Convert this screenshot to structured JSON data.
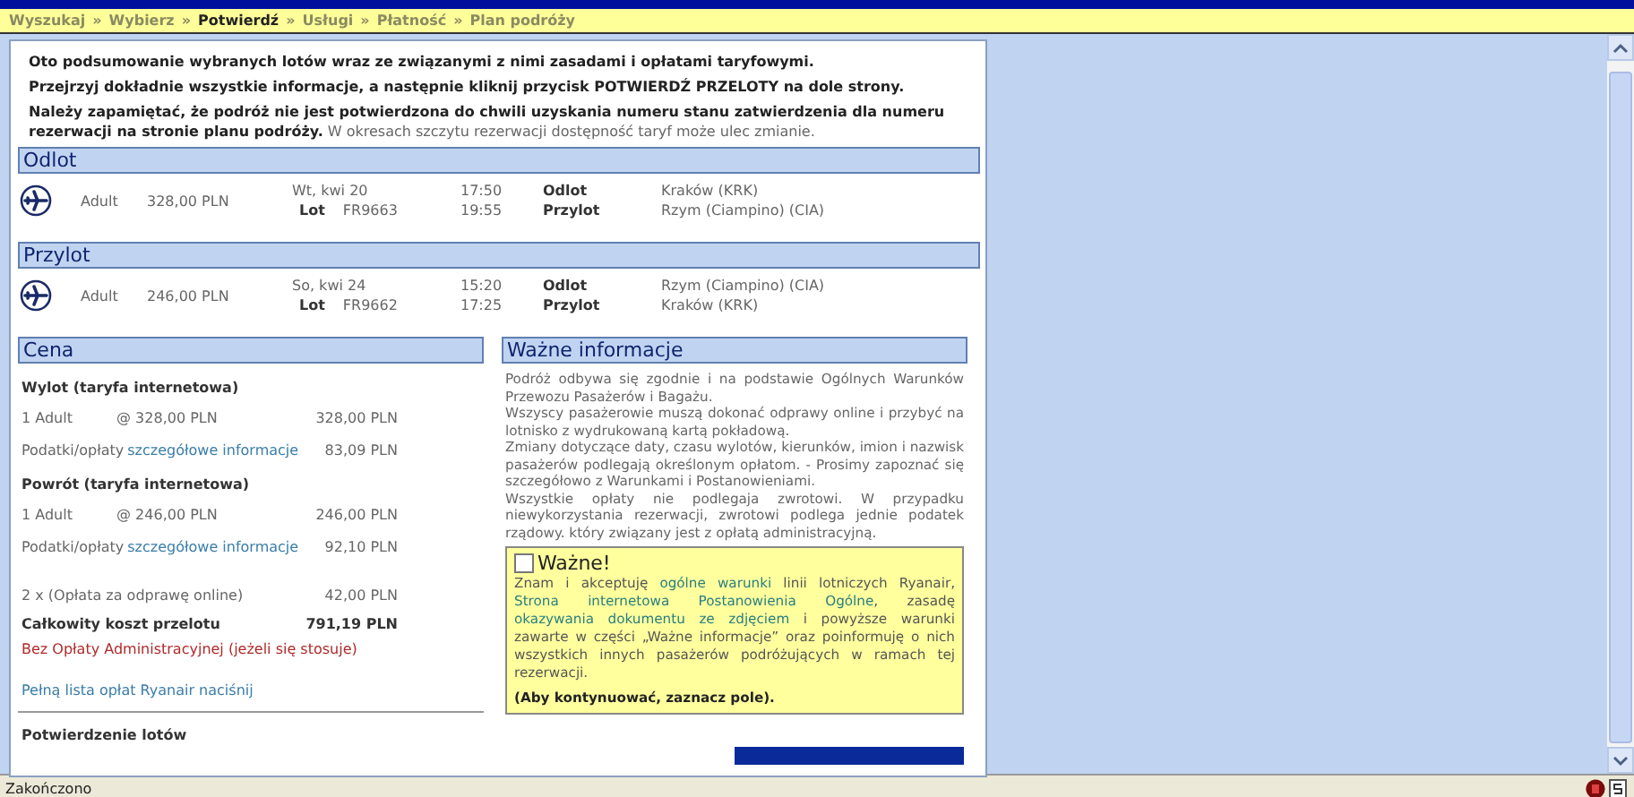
{
  "breadcrumb": [
    {
      "label": "Wyszukaj",
      "selected": false
    },
    {
      "label": "Wybierz",
      "selected": false
    },
    {
      "label": "Potwierdź",
      "selected": true
    },
    {
      "label": "Usługi",
      "selected": false
    },
    {
      "label": "Płatność",
      "selected": false
    },
    {
      "label": "Plan podróży",
      "selected": false
    }
  ],
  "breadcrumb_separator": "»",
  "intro": [
    {
      "text": "Oto podsumowanie wybranych lotów wraz ze związanymi z nimi zasadami i opłatami taryfowymi.",
      "strong": true
    },
    {
      "text": "Przejrzyj dokładnie wszystkie informacje, a następnie kliknij przycisk POTWIERDŹ PRZELOTY na dole strony.",
      "strong": true
    },
    {
      "text": "**Należy zapamiętać, że podróż nie jest potwierdzona do chwili uzyskania numeru stanu zatwierdzenia dla numeru rezerwacji na stronie planu podróży.** W okresach szczytu rezerwacji dostępność taryf może ulec zmianie.",
      "strong": false
    }
  ],
  "flights": [
    {
      "title": "Odlot",
      "rows": [
        {
          "passenger": "Adult",
          "price": "328,00 PLN",
          "date": "Wt, kwi 20",
          "flight_label": "Lot",
          "flight_number": "FR9663",
          "departure_time": "17:50",
          "arrival_time": "19:55",
          "departure_label": "Odlot",
          "arrival_label": "Przylot",
          "departure_airport": "Kraków (KRK)",
          "arrival_airport": "Rzym (Ciampino) (CIA)"
        }
      ]
    },
    {
      "title": "Przylot",
      "rows": [
        {
          "passenger": "Adult",
          "price": "246,00 PLN",
          "date": "So, kwi 24",
          "flight_label": "Lot",
          "flight_number": "FR9662",
          "departure_time": "15:20",
          "arrival_time": "17:25",
          "departure_label": "Odlot",
          "arrival_label": "Przylot",
          "departure_airport": "Rzym (Ciampino) (CIA)",
          "arrival_airport": "Kraków (KRK)"
        }
      ]
    }
  ],
  "price": {
    "title": "Cena",
    "lines": [
      {
        "kind": "heading",
        "label": "Wylot (taryfa internetowa)"
      },
      {
        "kind": "item",
        "label": "1 Adult",
        "unit_price": "@ 328,00 PLN",
        "amount": "328,00 PLN"
      },
      {
        "kind": "tax",
        "label": "Podatki/opłaty",
        "link": "szczegółowe informacje",
        "amount": "83,09 PLN"
      },
      {
        "kind": "heading",
        "label": "Powrót (taryfa internetowa)"
      },
      {
        "kind": "item",
        "label": "1 Adult",
        "unit_price": "@ 246,00 PLN",
        "amount": "246,00 PLN"
      },
      {
        "kind": "tax",
        "label": "Podatki/opłaty",
        "link": "szczegółowe informacje",
        "amount": "92,10 PLN"
      },
      {
        "kind": "fee",
        "label": "2 x (Opłata za odprawę online)",
        "amount": "42,00 PLN"
      },
      {
        "kind": "total",
        "label": "Całkowity koszt przelotu",
        "amount": "791,19 PLN"
      },
      {
        "kind": "note",
        "label": "Bez Opłaty Administracyjnej (jeżeli się stosuje)"
      },
      {
        "kind": "link",
        "label": "Pełną lista opłat Ryanair naciśnij"
      }
    ],
    "confirm_heading": "Potwierdzenie lotów"
  },
  "info": {
    "title": "Ważne informacje",
    "paragraphs": [
      "Podróż odbywa się zgodnie i na podstawie Ogólnych Warunków Przewozu Pasażerów i Bagażu.",
      "Wszyscy pasażerowie muszą dokonać odprawy online i przybyć na lotnisko z wydrukowaną kartą pokładową.",
      "Zmiany dotyczące daty, czasu wylotów, kierunków, imion i nazwisk pasażerów podlegają określonym opłatom. - Prosimy zapoznać się szczegółowo z Warunkami i Postanowieniami.",
      "Wszystkie opłaty nie podlegaja zwrotowi. W przypadku niewykorzystania rezerwacji, zwrotowi podlega jednie podatek rządowy. który związany jest z opłatą administracyjną."
    ],
    "consent": {
      "checked": false,
      "label": "Ważne!",
      "segments": [
        {
          "kind": "text",
          "text": "Znam i akceptuję "
        },
        {
          "kind": "link",
          "text": "ogólne warunki"
        },
        {
          "kind": "text",
          "text": " linii lotniczych Ryanair, "
        },
        {
          "kind": "link",
          "text": "Strona internetowa Postanowienia Ogólne"
        },
        {
          "kind": "text",
          "text": ", zasadę "
        },
        {
          "kind": "link",
          "text": "okazywania dokumentu ze zdjęciem"
        },
        {
          "kind": "text",
          "text": " i powyższe warunki zawarte w części „Ważne informacje” oraz poinformuję o nich wszystkich innych pasażerów podróżujących w ramach tej rezerwacji."
        }
      ],
      "hint": "(Aby kontynuować, zaznacz pole)."
    }
  },
  "status_bar": {
    "text": "Zakończono"
  }
}
